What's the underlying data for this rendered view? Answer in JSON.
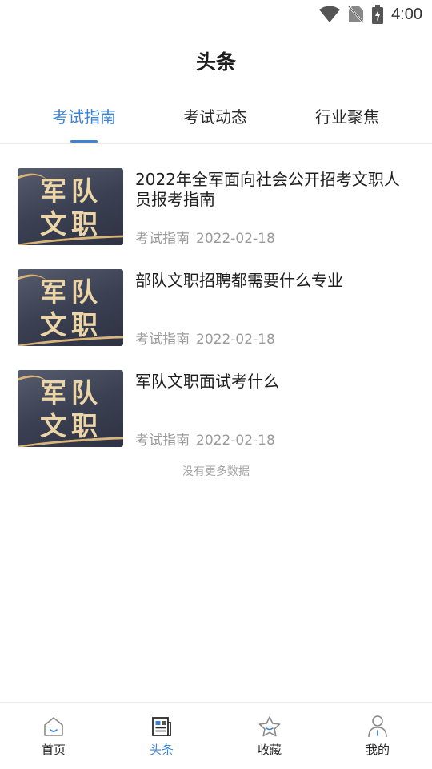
{
  "status_bar": {
    "time": "4:00"
  },
  "header": {
    "title": "头条"
  },
  "tabs": [
    {
      "label": "考试指南",
      "active": true
    },
    {
      "label": "考试动态",
      "active": false
    },
    {
      "label": "行业聚焦",
      "active": false
    }
  ],
  "articles": [
    {
      "thumb_line1": "军队",
      "thumb_line2": "文职",
      "title": "2022年全军面向社会公开招考文职人员报考指南",
      "category": "考试指南",
      "date": "2022-02-18"
    },
    {
      "thumb_line1": "军队",
      "thumb_line2": "文职",
      "title": "部队文职招聘都需要什么专业",
      "category": "考试指南",
      "date": "2022-02-18"
    },
    {
      "thumb_line1": "军队",
      "thumb_line2": "文职",
      "title": "军队文职面试考什么",
      "category": "考试指南",
      "date": "2022-02-18"
    }
  ],
  "list_footer": "没有更多数据",
  "bottom_nav": [
    {
      "label": "首页",
      "icon": "home-icon",
      "active": false
    },
    {
      "label": "头条",
      "icon": "news-icon",
      "active": true
    },
    {
      "label": "收藏",
      "icon": "star-icon",
      "active": false
    },
    {
      "label": "我的",
      "icon": "profile-icon",
      "active": false
    }
  ],
  "colors": {
    "accent": "#3d83d4",
    "text": "#222222",
    "muted": "#9a9a9a",
    "thumb_gold": "#ecd6a7",
    "thumb_bg": "#3b4052"
  }
}
